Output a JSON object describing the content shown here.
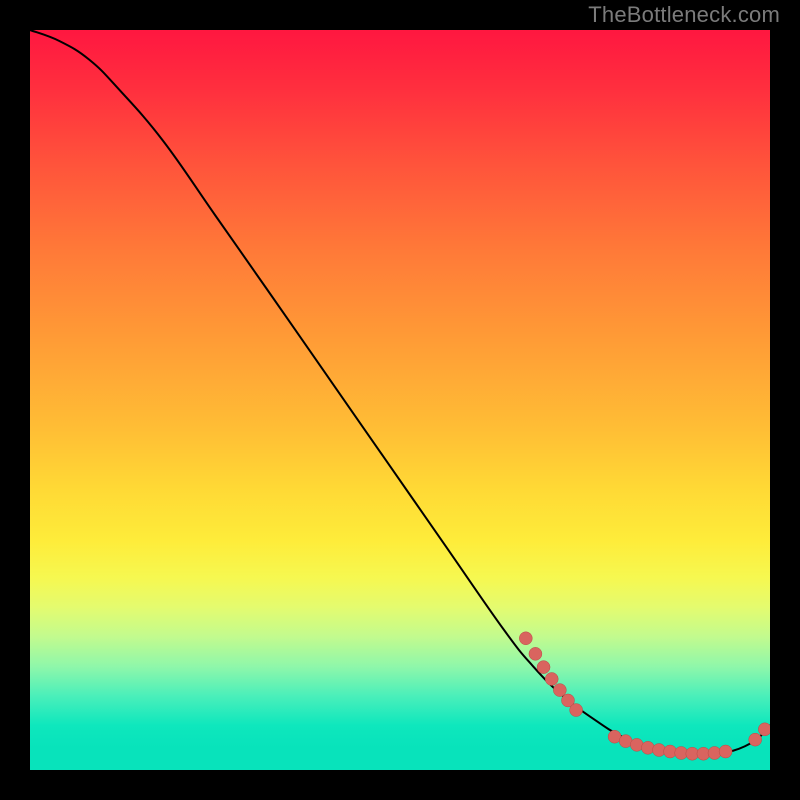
{
  "watermark": "TheBottleneck.com",
  "colors": {
    "line": "#000000",
    "dot_fill": "#d9645f",
    "dot_stroke": "#b94b46",
    "background": "#000000"
  },
  "chart_data": {
    "type": "line",
    "title": "",
    "xlabel": "",
    "ylabel": "",
    "xlim": [
      0,
      100
    ],
    "ylim": [
      0,
      100
    ],
    "series": [
      {
        "name": "curve",
        "x": [
          0,
          4,
          8,
          12,
          18,
          25,
          32,
          40,
          48,
          56,
          64,
          68,
          72,
          76,
          80,
          84,
          88,
          92,
          95,
          98,
          100
        ],
        "y": [
          100,
          98.5,
          96,
          92,
          85,
          75,
          65,
          53.5,
          42,
          30.5,
          19,
          14,
          10,
          7,
          4.5,
          3,
          2.3,
          2.2,
          2.6,
          4,
          6
        ]
      }
    ],
    "dot_clusters": [
      {
        "name": "upper-cluster",
        "points": [
          {
            "x": 67,
            "y": 17.8
          },
          {
            "x": 68.3,
            "y": 15.7
          },
          {
            "x": 69.4,
            "y": 13.9
          },
          {
            "x": 70.5,
            "y": 12.3
          },
          {
            "x": 71.6,
            "y": 10.8
          },
          {
            "x": 72.7,
            "y": 9.4
          },
          {
            "x": 73.8,
            "y": 8.1
          }
        ]
      },
      {
        "name": "lower-cluster",
        "points": [
          {
            "x": 79,
            "y": 4.5
          },
          {
            "x": 80.5,
            "y": 3.9
          },
          {
            "x": 82,
            "y": 3.4
          },
          {
            "x": 83.5,
            "y": 3.0
          },
          {
            "x": 85,
            "y": 2.7
          },
          {
            "x": 86.5,
            "y": 2.5
          },
          {
            "x": 88,
            "y": 2.3
          },
          {
            "x": 89.5,
            "y": 2.2
          },
          {
            "x": 91,
            "y": 2.2
          },
          {
            "x": 92.5,
            "y": 2.3
          },
          {
            "x": 94,
            "y": 2.5
          }
        ]
      },
      {
        "name": "right-pair",
        "points": [
          {
            "x": 98,
            "y": 4.1
          },
          {
            "x": 99.3,
            "y": 5.5
          }
        ]
      }
    ]
  }
}
